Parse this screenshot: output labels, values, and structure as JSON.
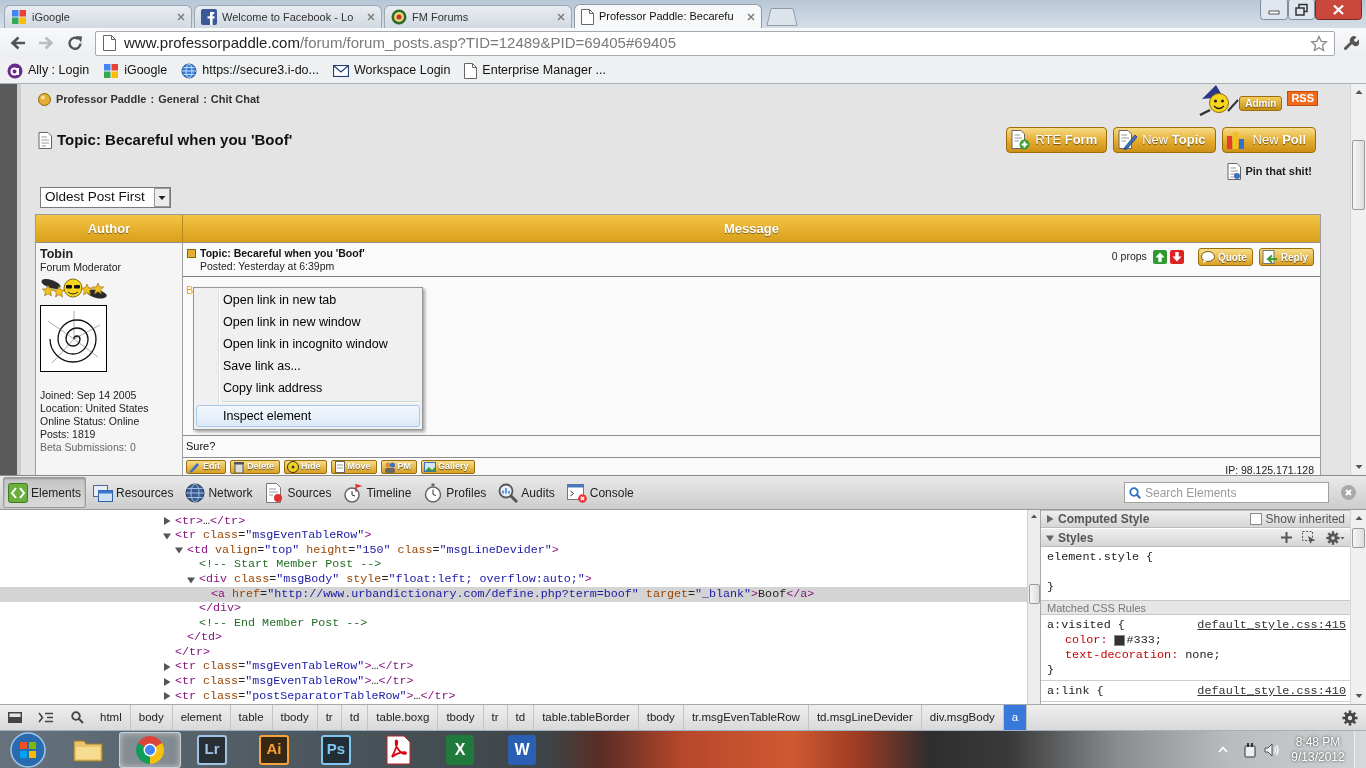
{
  "tabs": [
    {
      "title": "iGoogle",
      "kind": "tiles",
      "selected": false
    },
    {
      "title": "Welcome to Facebook - Lo",
      "kind": "f",
      "selected": false
    },
    {
      "title": "FM Forums",
      "kind": "badge",
      "selected": false
    },
    {
      "title": "Professor Paddle: Becarefu",
      "kind": "page",
      "selected": true
    }
  ],
  "navigation": [
    {
      "kind": "back",
      "disabled": false
    },
    {
      "kind": "forward",
      "disabled": true
    },
    {
      "kind": "reload",
      "disabled": false
    }
  ],
  "address_bar": {
    "host": "www.professorpaddle.com",
    "path": "/forum/forum_posts.asp?TID=12489&PID=69405#69405"
  },
  "bookmarks": [
    {
      "label": "Ally : Login",
      "kind": "circle"
    },
    {
      "label": "iGoogle",
      "kind": "tiles"
    },
    {
      "label": "https://secure3.i-do...",
      "kind": "globe"
    },
    {
      "label": "Workspace Login",
      "kind": "envelope"
    },
    {
      "label": "Enterprise Manager ...",
      "kind": "page"
    }
  ],
  "forum": {
    "breadcrumb": [
      {
        "label": "Professor Paddle",
        "separator": ":"
      },
      {
        "label": "General",
        "separator": ":"
      },
      {
        "label": "Chit Chat"
      }
    ],
    "admin_badge": "Admin",
    "rss_badge": "RSS",
    "topic_title": "Topic: Becareful when you 'Boof'",
    "actions": [
      {
        "label": "RTE **Form**",
        "kind": "form"
      },
      {
        "label": "New **Topic**",
        "kind": "pencil"
      },
      {
        "label": "New **Poll**",
        "kind": "poll"
      }
    ],
    "pin_link": "Pin that shit!",
    "sort_select": {
      "value": "Oldest Post First"
    },
    "columns": [
      "Author",
      "Message"
    ],
    "post": {
      "author": {
        "name": "Tobin",
        "rank": "Forum Moderator",
        "details": [
          {
            "text": "Joined: Sep 14 2005",
            "muted": false
          },
          {
            "text": "Location: United States",
            "muted": false
          },
          {
            "text": "Online Status: Online",
            "muted": false
          },
          {
            "text": "Posts: 1819",
            "muted": false
          },
          {
            "text": "Beta Submissions: 0",
            "muted": true
          }
        ]
      },
      "title": "Topic: Becareful when you 'Boof'",
      "posted": "Posted: Yesterday at 6:39pm",
      "props": "0 props",
      "reply_buttons": [
        {
          "label": "Quote",
          "kind": "quote"
        },
        {
          "label": "Reply",
          "kind": "reply"
        }
      ],
      "body_link": "B",
      "signature": "Sure?",
      "tools": [
        {
          "label": "Edit",
          "kind": "pencil"
        },
        {
          "label": "Delete",
          "kind": "trash"
        },
        {
          "label": "Hide",
          "kind": "hazard"
        },
        {
          "label": "Move",
          "kind": "document"
        },
        {
          "label": "PM",
          "kind": "people"
        },
        {
          "label": "Gallery",
          "kind": "picture"
        }
      ],
      "ip": "IP: 98.125.171.128"
    }
  },
  "context_menu": {
    "groups": [
      [
        {
          "label": "Open link in new tab",
          "highlighted": false
        },
        {
          "label": "Open link in new window",
          "highlighted": false
        },
        {
          "label": "Open link in incognito window",
          "highlighted": false
        },
        {
          "label": "Save link as...",
          "highlighted": false
        },
        {
          "label": "Copy link address",
          "highlighted": false
        }
      ],
      [
        {
          "label": "Inspect element",
          "highlighted": true
        }
      ]
    ]
  },
  "devtools": {
    "tabs": [
      {
        "label": "Elements",
        "kind": "code",
        "selected": true
      },
      {
        "label": "Resources",
        "kind": "windows",
        "selected": false
      },
      {
        "label": "Network",
        "kind": "globe",
        "selected": false
      },
      {
        "label": "Sources",
        "kind": "bugdoc",
        "selected": false
      },
      {
        "label": "Timeline",
        "kind": "flagwatch",
        "selected": false
      },
      {
        "label": "Profiles",
        "kind": "stopwatch",
        "selected": false
      },
      {
        "label": "Audits",
        "kind": "magnifier",
        "selected": false
      },
      {
        "label": "Console",
        "kind": "terminal",
        "selected": false
      }
    ],
    "search": {
      "placeholder": "Search Elements"
    },
    "dom_tree": [
      {
        "markup": "<tr>…</tr>",
        "expanded": false,
        "selected": false
      },
      {
        "markup": "<tr class=\"msgEvenTableRow\">",
        "closing": "</tr>",
        "expanded": true,
        "selected": false,
        "children": [
          {
            "markup": "<td valign=\"top\" height=\"150\" class=\"msgLineDevider\">",
            "closing": "</td>",
            "expanded": true,
            "selected": false,
            "children": [
              {
                "markup": "<!-- Start Member Post -->",
                "selected": false
              },
              {
                "markup": "<div class=\"msgBody\" style=\"float:left; overflow:auto;\">",
                "closing": "</div>",
                "expanded": true,
                "selected": false,
                "children": [
                  {
                    "markup": "<a href=\"http://www.urbandictionary.com/define.php?term=boof\" target=\"_blank\">Boof</a>",
                    "selected": true
                  }
                ]
              },
              {
                "markup": "<!-- End Member Post -->",
                "selected": false
              }
            ]
          }
        ]
      },
      {
        "markup": "<tr class=\"msgEvenTableRow\">…</tr>",
        "expanded": false,
        "selected": false
      },
      {
        "markup": "<tr class=\"msgEvenTableRow\">…</tr>",
        "expanded": false,
        "selected": false
      },
      {
        "markup": "<tr class=\"postSeparatorTableRow\">…</tr>",
        "expanded": false,
        "selected": false
      }
    ],
    "sidebar": {
      "computed": {
        "title": "Computed Style",
        "expanded": false
      },
      "show_inherited": {
        "label": "Show inherited",
        "checked": false
      },
      "styles": {
        "title": "Styles",
        "expanded": true
      },
      "element_style": {
        "open": "element.style {",
        "close": "}"
      },
      "matched_title": "Matched CSS Rules",
      "rules": [
        {
          "open": "a:visited {",
          "source": "default_style.css:415",
          "properties": [
            {
              "name": "color:",
              "value": "#333;",
              "kind": "color"
            },
            {
              "name": "text-decoration:",
              "value": "none;",
              "kind": "keyword"
            }
          ],
          "close": "}"
        },
        {
          "open": "a:link {",
          "source": "default_style.css:410"
        }
      ]
    },
    "breadcrumbs": [
      {
        "label": "html",
        "selected": false
      },
      {
        "label": "body",
        "selected": false
      },
      {
        "label": "element",
        "selected": false
      },
      {
        "label": "table",
        "selected": false
      },
      {
        "label": "tbody",
        "selected": false
      },
      {
        "label": "tr",
        "selected": false
      },
      {
        "label": "td",
        "selected": false
      },
      {
        "label": "table.boxg",
        "selected": false
      },
      {
        "label": "tbody",
        "selected": false
      },
      {
        "label": "tr",
        "selected": false
      },
      {
        "label": "td",
        "selected": false
      },
      {
        "label": "table.tableBorder",
        "selected": false
      },
      {
        "label": "tbody",
        "selected": false
      },
      {
        "label": "tr.msgEvenTableRow",
        "selected": false
      },
      {
        "label": "td.msgLineDevider",
        "selected": false
      },
      {
        "label": "div.msgBody",
        "selected": false
      },
      {
        "label": "a",
        "selected": true
      }
    ]
  },
  "taskbar": {
    "apps": [
      {
        "kind": "folder",
        "selected": false
      },
      {
        "kind": "chrome",
        "selected": true
      },
      {
        "kind": "dark-tile",
        "label": "Lr",
        "color": "#9ec3e6",
        "selected": false
      },
      {
        "kind": "dark-tile",
        "label": "Ai",
        "color": "#f7a13a",
        "selected": false
      },
      {
        "kind": "dark-tile",
        "label": "Ps",
        "color": "#7fc6f0",
        "selected": false
      },
      {
        "kind": "pdf",
        "selected": false
      },
      {
        "kind": "color-tile",
        "label": "X",
        "color": "#1f7a3c",
        "selected": false
      },
      {
        "kind": "color-tile",
        "label": "W",
        "color": "#2b5fb3",
        "selected": false
      }
    ],
    "clock": {
      "time": "8:48 PM",
      "date": "9/13/2012"
    }
  }
}
